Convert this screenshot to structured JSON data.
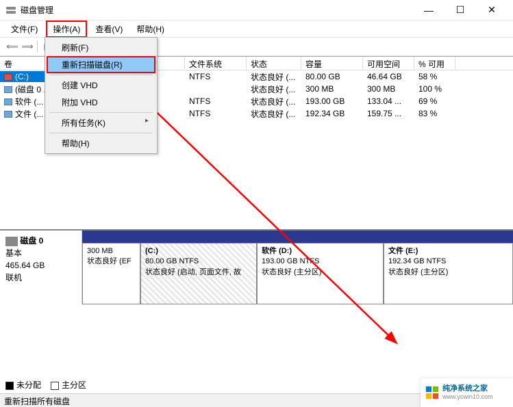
{
  "window": {
    "title": "磁盘管理"
  },
  "menu": {
    "file": "文件(F)",
    "action": "操作(A)",
    "view": "查看(V)",
    "help": "帮助(H)"
  },
  "dropdown": {
    "refresh": "刷新(F)",
    "rescan": "重新扫描磁盘(R)",
    "createVHD": "创建 VHD",
    "attachVHD": "附加 VHD",
    "allTasks": "所有任务(K)",
    "help": "帮助(H)"
  },
  "grid": {
    "headers": [
      "卷",
      "",
      "文件系统",
      "状态",
      "容量",
      "可用空间",
      "% 可用"
    ],
    "rows": [
      {
        "name": "(C:)",
        "fs": "NTFS",
        "status": "状态良好 (...",
        "size": "80.00 GB",
        "free": "46.64 GB",
        "pct": "58 %",
        "selected": true
      },
      {
        "name": "(磁盘 0 ...",
        "fs": "",
        "status": "状态良好 (...",
        "size": "300 MB",
        "free": "300 MB",
        "pct": "100 %",
        "selected": false
      },
      {
        "name": "软件 (...",
        "fs": "NTFS",
        "status": "状态良好 (...",
        "size": "193.00 GB",
        "free": "133.04 ...",
        "pct": "69 %",
        "selected": false
      },
      {
        "name": "文件 (...",
        "fs": "NTFS",
        "status": "状态良好 (...",
        "size": "192.34 GB",
        "free": "159.75 ...",
        "pct": "83 %",
        "selected": false
      }
    ]
  },
  "disk": {
    "label": "磁盘 0",
    "type": "基本",
    "size": "465.64 GB",
    "state": "联机",
    "parts": [
      {
        "title": "",
        "line1": "300 MB",
        "line2": "状态良好 (EF"
      },
      {
        "title": "(C:)",
        "line1": "80.00 GB NTFS",
        "line2": "状态良好 (启动, 页面文件, 故"
      },
      {
        "title": "软件   (D:)",
        "line1": "193.00 GB NTFS",
        "line2": "状态良好 (主分区)"
      },
      {
        "title": "文件   (E:)",
        "line1": "192.34 GB NTFS",
        "line2": "状态良好 (主分区)"
      }
    ]
  },
  "legend": {
    "unalloc": "未分配",
    "primary": "主分区"
  },
  "status": "重新扫描所有磁盘",
  "wm": {
    "name": "纯净系统之家",
    "url": "www.ycwin10.com"
  }
}
